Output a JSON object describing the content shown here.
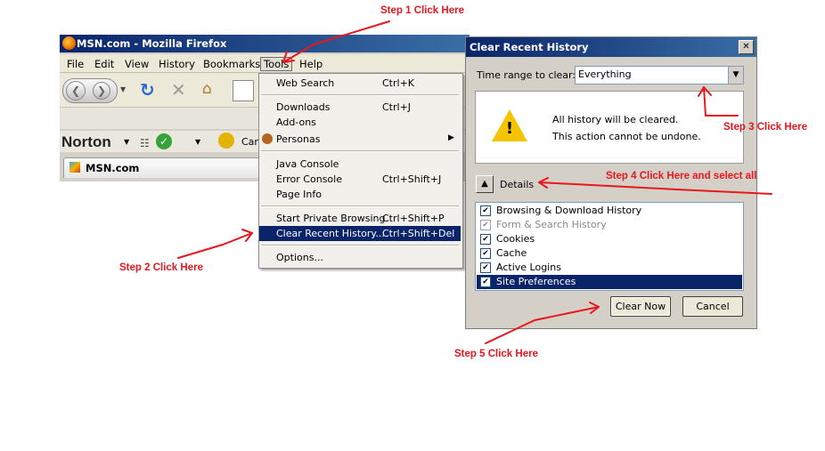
{
  "window": {
    "title": "MSN.com - Mozilla Firefox",
    "menubar": [
      "File",
      "Edit",
      "View",
      "History",
      "Bookmarks",
      "Tools",
      "Help"
    ],
    "toolbar_partial_text": "Car",
    "norton": "Norton",
    "tab_title": "MSN.com"
  },
  "tools_menu": {
    "items": [
      {
        "label": "Web Search",
        "shortcut": "Ctrl+K"
      },
      {
        "label": "Downloads",
        "shortcut": "Ctrl+J"
      },
      {
        "label": "Add-ons",
        "shortcut": ""
      },
      {
        "label": "Personas",
        "shortcut": ""
      },
      {
        "label": "Java Console",
        "shortcut": ""
      },
      {
        "label": "Error Console",
        "shortcut": "Ctrl+Shift+J"
      },
      {
        "label": "Page Info",
        "shortcut": ""
      },
      {
        "label": "Start Private Browsing",
        "shortcut": "Ctrl+Shift+P"
      },
      {
        "label": "Clear Recent History...",
        "shortcut": "Ctrl+Shift+Del"
      },
      {
        "label": "Options...",
        "shortcut": ""
      }
    ]
  },
  "dialog": {
    "title": "Clear Recent History",
    "close": "✕",
    "range_label": "Time range to clear:",
    "range_value": "Everything",
    "warning_line1": "All history will be cleared.",
    "warning_line2": "This action cannot be undone.",
    "details_label": "Details",
    "items": [
      {
        "label": "Browsing & Download History",
        "checked": true
      },
      {
        "label": "Form & Search History",
        "checked": true
      },
      {
        "label": "Cookies",
        "checked": true
      },
      {
        "label": "Cache",
        "checked": true
      },
      {
        "label": "Active Logins",
        "checked": true
      },
      {
        "label": "Site Preferences",
        "checked": true
      }
    ],
    "clear_now": "Clear Now",
    "cancel": "Cancel"
  },
  "annotations": {
    "step1": "Step 1 Click Here",
    "step2": "Step  2 Click Here",
    "step3": "Step  3 Click Here",
    "step4": "Step 4 Click Here and select all",
    "step5": "Step 5 Click Here"
  },
  "colors": {
    "annotation": "#e8161e",
    "title_bar": "#0a246a",
    "highlight": "#0a246a"
  }
}
